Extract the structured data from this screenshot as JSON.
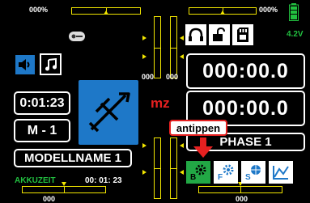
{
  "top_left_trim": {
    "pct": "000%"
  },
  "top_right_trim": {
    "pct": "000%"
  },
  "bottom_left_trim": {
    "value": "000"
  },
  "bottom_right_trim": {
    "value": "000"
  },
  "left_vertical_trim": {
    "value": "000"
  },
  "right_vertical_trim": {
    "value": "000"
  },
  "battery": {
    "voltage": "4.2V"
  },
  "timers": {
    "top": "000:00.0",
    "middle": "000:00.0"
  },
  "clock": {
    "value": "0:01:23"
  },
  "model": {
    "memory": "M - 1",
    "name": "MODELLNAME  1"
  },
  "akku": {
    "label": "AKKUZEIT",
    "value": "00: 01: 23"
  },
  "mode_label": "mz",
  "phase": {
    "name": "PHASE 1"
  },
  "callout": {
    "text": "antippen"
  },
  "colors": {
    "accent_blue": "#1e78c8",
    "accent_green": "#22a845",
    "trim_yellow": "#f2e600",
    "alert_red": "#e62020"
  },
  "icons": [
    "key-icon",
    "speaker-icon",
    "music-note-icon",
    "headphones-icon",
    "padlock-icon",
    "sd-card-icon",
    "airplane-icon",
    "gear-b-icon",
    "gear-f-icon",
    "globe-s-icon",
    "graph-icon",
    "battery-icon"
  ]
}
